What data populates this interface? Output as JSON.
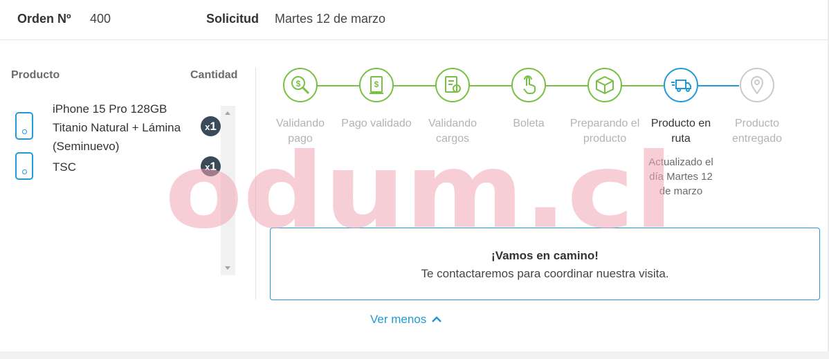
{
  "header": {
    "order_label": "Orden Nº",
    "order_value": "400",
    "request_label": "Solicitud",
    "request_value": "Martes 12 de marzo"
  },
  "products": {
    "col_product": "Producto",
    "col_quantity": "Cantidad",
    "items": [
      {
        "name": "iPhone 15 Pro 128GB Titanio Natural + Lámina (Seminuevo)",
        "qty": "1",
        "qty_prefix": "x"
      },
      {
        "name": "TSC",
        "qty": "1",
        "qty_prefix": "x"
      }
    ]
  },
  "tracking": {
    "steps": [
      {
        "label": "Validando pago",
        "icon": "dollar-search-icon",
        "state": "done"
      },
      {
        "label": "Pago validado",
        "icon": "document-dollar-icon",
        "state": "done"
      },
      {
        "label": "Validando cargos",
        "icon": "document-check-icon",
        "state": "done"
      },
      {
        "label": "Boleta",
        "icon": "hand-pointer-icon",
        "state": "done"
      },
      {
        "label": "Preparando el producto",
        "icon": "package-box-icon",
        "state": "done"
      },
      {
        "label": "Producto en ruta",
        "icon": "delivery-truck-icon",
        "state": "active"
      },
      {
        "label": "Producto entregado",
        "icon": "location-pin-icon",
        "state": "pending"
      }
    ],
    "updated_text": "Actualizado el día Martes 12 de marzo"
  },
  "message": {
    "title": "¡Vamos en camino!",
    "text": "Te contactaremos para coordinar nuestra visita."
  },
  "toggle": {
    "label": "Ver menos"
  },
  "watermark": {
    "text": "odum.cl"
  },
  "colors": {
    "done": "#76c043",
    "active": "#1f9ad6",
    "pending": "#c9c9c9",
    "badge": "#3a4a59",
    "watermark": "#f3a5b4"
  }
}
